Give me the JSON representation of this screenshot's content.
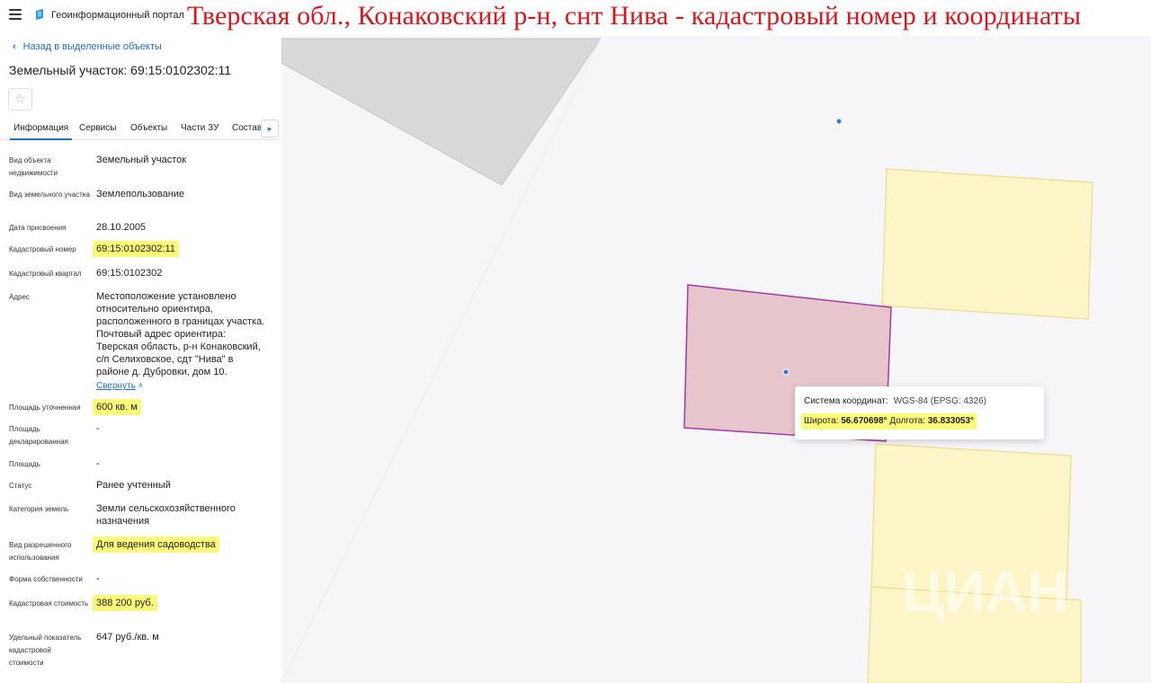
{
  "header": {
    "menu_icon": "hamburger-icon",
    "brand_icon": "portal-logo-icon",
    "brand_text": "Геоинформационный портал",
    "banner_title": "Тверская обл., Конаковский р-н, снт Нива - кадастровый номер и координаты"
  },
  "sidebar": {
    "back_label": "Назад в выделенные объекты",
    "title": "Земельный участок: 69:15:0102302:11",
    "favorite_icon": "star-icon",
    "tabs": [
      "Информация",
      "Сервисы",
      "Объекты",
      "Части ЗУ",
      "Состав"
    ],
    "tab_more_icon": "chevron-right-icon",
    "collapse_label": "Свернуть",
    "properties": [
      {
        "label": "Вид объекта недвижимости",
        "value": "Земельный участок"
      },
      {
        "label": "Вид земельного участка",
        "value": "Землепользование"
      },
      {
        "label": "Дата присвоения",
        "value": "28.10.2005"
      },
      {
        "label": "Кадастровый номер",
        "value": "69:15:0102302:11"
      },
      {
        "label": "Кадастровый квартал",
        "value": "69:15:0102302"
      },
      {
        "label": "Адрес",
        "value": "Местоположение установлено относительно ориентира, расположенного в границах участка. Почтовый адрес ориентира: Тверская область, р-н Конаковский, с/п Селиховское, сдт \"Нива\" в районе д. Дубровки, дом 10."
      },
      {
        "label": "Площадь уточненная",
        "value": "600 кв. м"
      },
      {
        "label": "Площадь декларированная",
        "value": "-"
      },
      {
        "label": "Площадь",
        "value": "-"
      },
      {
        "label": "Статус",
        "value": "Ранее учтенный"
      },
      {
        "label": "Категория земель",
        "value": "Земли сельскохозяйственного назначения"
      },
      {
        "label": "Вид разрешенного использования",
        "value": "Для ведения садоводства"
      },
      {
        "label": "Форма собственности",
        "value": "-"
      },
      {
        "label": "Кадастровая стоимость",
        "value": "388 200 руб."
      },
      {
        "label": "Удельный показатель кадастровой стоимости",
        "value": "647 руб./кв. м"
      }
    ]
  },
  "popup": {
    "crs_label": "Система координат:",
    "crs_value": "WGS-84 (EPSG: 4326)",
    "lat_label": "Широта:",
    "lat_value": "56.670698°",
    "lon_label": "Долгота:",
    "lon_value": "36.833053°"
  },
  "map": {
    "watermark_text": "ЦИАН",
    "colors": {
      "selected_fill": "#e6c6cc",
      "selected_stroke": "#a23aa6",
      "neighbor_fill": "#fbf5c8",
      "neighbor_stroke": "#e8d77a",
      "gray_fill": "#d9d9d9",
      "marker": "#2a79d8",
      "highlight": "#fbf97a"
    }
  }
}
